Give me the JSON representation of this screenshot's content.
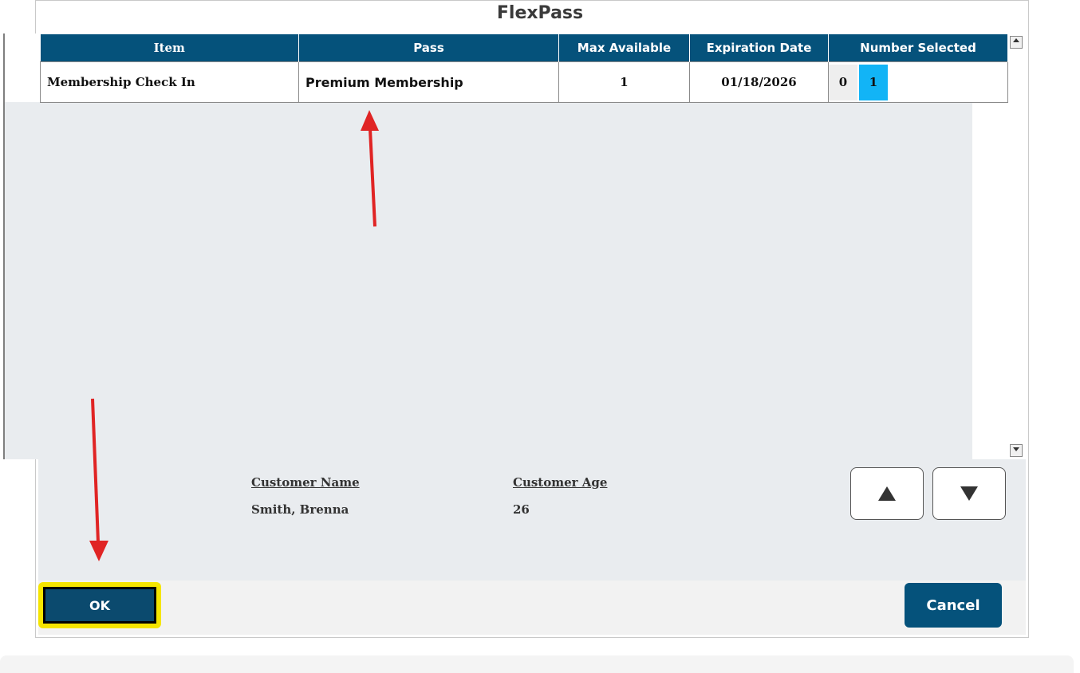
{
  "dialog": {
    "title": "FlexPass"
  },
  "table": {
    "columns": [
      "Item",
      "Pass",
      "Max Available",
      "Expiration Date",
      "Number Selected"
    ],
    "rows": [
      {
        "item": "Membership Check In",
        "pass": "Premium Membership",
        "max_available": "1",
        "expiration_date": "01/18/2026",
        "number_options": [
          "0",
          "1"
        ],
        "selected_option": "1"
      }
    ]
  },
  "customer": {
    "name_label": "Customer Name",
    "name_value": "Smith, Brenna",
    "age_label": "Customer Age",
    "age_value": "26"
  },
  "scroll": {
    "up_icon": "triangle-up-icon",
    "down_icon": "triangle-down-icon"
  },
  "buttons": {
    "ok_label": "OK",
    "cancel_label": "Cancel"
  },
  "colors": {
    "header_bg": "#05527b",
    "selected_number": "#12b4f6",
    "highlight": "#f5e500",
    "annotation_arrow": "#e02424"
  }
}
